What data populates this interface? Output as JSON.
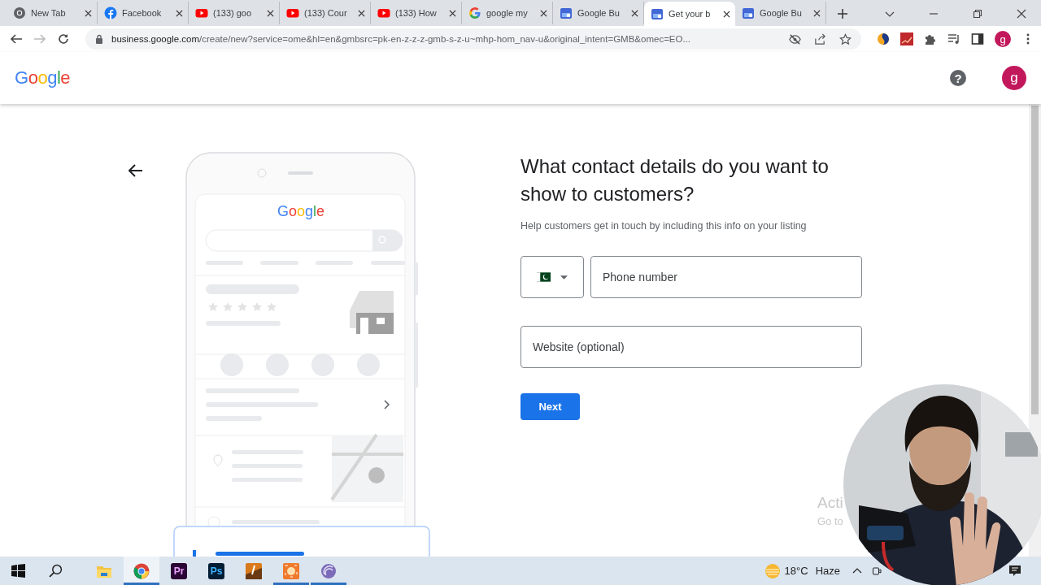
{
  "browser": {
    "tabs": [
      {
        "title": "New Tab",
        "kind": "chrome",
        "selected": false
      },
      {
        "title": "Facebook",
        "kind": "facebook",
        "selected": false
      },
      {
        "title": "(133) goo",
        "kind": "youtube",
        "selected": false
      },
      {
        "title": "(133) Cour",
        "kind": "youtube",
        "selected": false
      },
      {
        "title": "(133) How",
        "kind": "youtube",
        "selected": false
      },
      {
        "title": "google my",
        "kind": "google",
        "selected": false
      },
      {
        "title": "Google Bu",
        "kind": "business",
        "selected": false
      },
      {
        "title": "Get your b",
        "kind": "business",
        "selected": true
      },
      {
        "title": "Google Bu",
        "kind": "business",
        "selected": false
      }
    ],
    "address": {
      "host": "business.google.com",
      "path": "/create/new?service=ome&hl=en&gmbsrc=pk-en-z-z-z-gmb-s-z-u~mhp-hom_nav-u&original_intent=GMB&omec=EO..."
    },
    "profile_initial": "g"
  },
  "header": {
    "logo": "Google",
    "help_glyph": "?",
    "avatar_initial": "g"
  },
  "illustration": {
    "logo": "Google"
  },
  "form": {
    "heading": "What contact details do you want to show to customers?",
    "subtitle": "Help customers get in touch by including this info on your listing",
    "phone_placeholder": "Phone number",
    "website_placeholder": "Website (optional)",
    "next_label": "Next"
  },
  "activation_notice": [
    "Acti",
    "Go to"
  ],
  "taskbar": {
    "apps": [
      {
        "kind": "explorer",
        "selected": false,
        "running": false
      },
      {
        "kind": "chrome",
        "selected": true,
        "running": true
      },
      {
        "kind": "premiere",
        "label": "Pr",
        "selected": false,
        "running": false
      },
      {
        "kind": "photoshop",
        "label": "Ps",
        "selected": false,
        "running": false
      },
      {
        "kind": "ipage",
        "selected": false,
        "running": false
      },
      {
        "kind": "recorder",
        "selected": false,
        "running": true
      },
      {
        "kind": "torrent",
        "selected": false,
        "running": true
      }
    ],
    "weather": {
      "temperature": "18°C",
      "condition": "Haze"
    }
  }
}
